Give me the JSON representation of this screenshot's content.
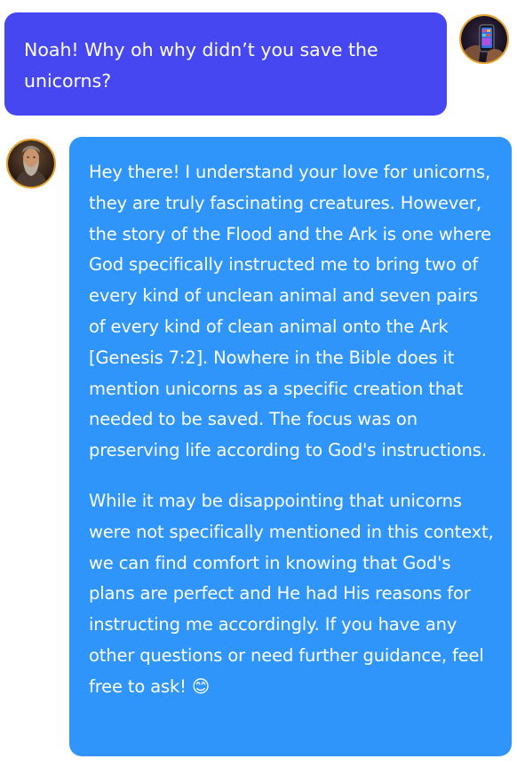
{
  "messages": {
    "user": {
      "text": "Noah! Why oh why didn’t you save the unicorns?",
      "avatar_icon": "user-avatar-phone-image"
    },
    "assistant": {
      "paragraphs": [
        "Hey there! I understand your love for unicorns, they are truly fascinating creatures. However, the story of the Flood and the Ark is one where God specifically instructed me to bring two of every kind of unclean animal and seven pairs of every kind of clean animal onto the Ark [Genesis 7:2]. Nowhere in the Bible does it mention unicorns as a specific creation that needed to be saved. The focus was on preserving life according to God's instructions.",
        "While it may be disappointing that unicorns were not specifically mentioned in this context, we can find comfort in knowing that God's plans are perfect and He had His reasons for instructing me accordingly. If you have any other questions or need further guidance, feel free to ask! 😊"
      ],
      "avatar_icon": "noah-avatar-bearded-man-image"
    }
  },
  "colors": {
    "user_bubble": "#4747f2",
    "assistant_bubble": "#2f95fb",
    "avatar_border": "#e8a12a",
    "text": "#ffffff"
  }
}
